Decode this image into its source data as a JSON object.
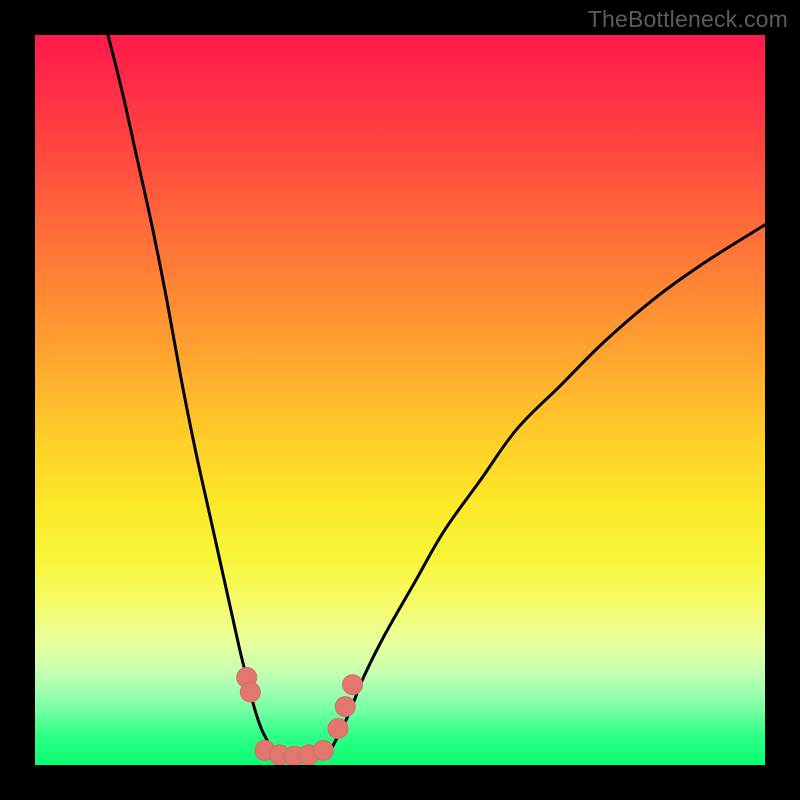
{
  "watermark": "TheBottleneck.com",
  "colors": {
    "background_frame": "#000000",
    "gradient_top": "#ff1a4b",
    "gradient_bottom": "#0aff72",
    "curve_stroke": "#000000",
    "marker_fill": "#e2776f",
    "marker_stroke": "#d96a62"
  },
  "chart_data": {
    "type": "line",
    "title": "",
    "xlabel": "",
    "ylabel": "",
    "xlim": [
      0,
      100
    ],
    "ylim": [
      0,
      100
    ],
    "series": [
      {
        "name": "left-curve",
        "x": [
          10,
          12,
          14,
          16,
          18,
          20,
          22,
          24,
          26,
          28,
          29,
          30,
          31,
          32,
          33
        ],
        "y": [
          100,
          92,
          83,
          74,
          64,
          53,
          43,
          34,
          25,
          16,
          12,
          8,
          5,
          3,
          1
        ]
      },
      {
        "name": "right-curve",
        "x": [
          40,
          41,
          43,
          45,
          48,
          52,
          56,
          61,
          66,
          72,
          78,
          85,
          92,
          100
        ],
        "y": [
          1,
          3,
          7,
          12,
          18,
          25,
          32,
          39,
          46,
          52,
          58,
          64,
          69,
          74
        ]
      },
      {
        "name": "floor-segment",
        "x": [
          31,
          40
        ],
        "y": [
          1,
          1
        ]
      }
    ],
    "markers": [
      {
        "name": "left-dot-1",
        "x": 29.0,
        "y": 12
      },
      {
        "name": "left-dot-2",
        "x": 29.5,
        "y": 10
      },
      {
        "name": "floor-dot-1",
        "x": 31.5,
        "y": 2.0
      },
      {
        "name": "floor-dot-2",
        "x": 33.5,
        "y": 1.4
      },
      {
        "name": "floor-dot-3",
        "x": 35.5,
        "y": 1.2
      },
      {
        "name": "floor-dot-4",
        "x": 37.5,
        "y": 1.4
      },
      {
        "name": "floor-dot-5",
        "x": 39.5,
        "y": 2.0
      },
      {
        "name": "right-dot-1",
        "x": 41.5,
        "y": 5
      },
      {
        "name": "right-dot-2",
        "x": 42.5,
        "y": 8
      },
      {
        "name": "right-dot-3",
        "x": 43.5,
        "y": 11
      }
    ]
  }
}
